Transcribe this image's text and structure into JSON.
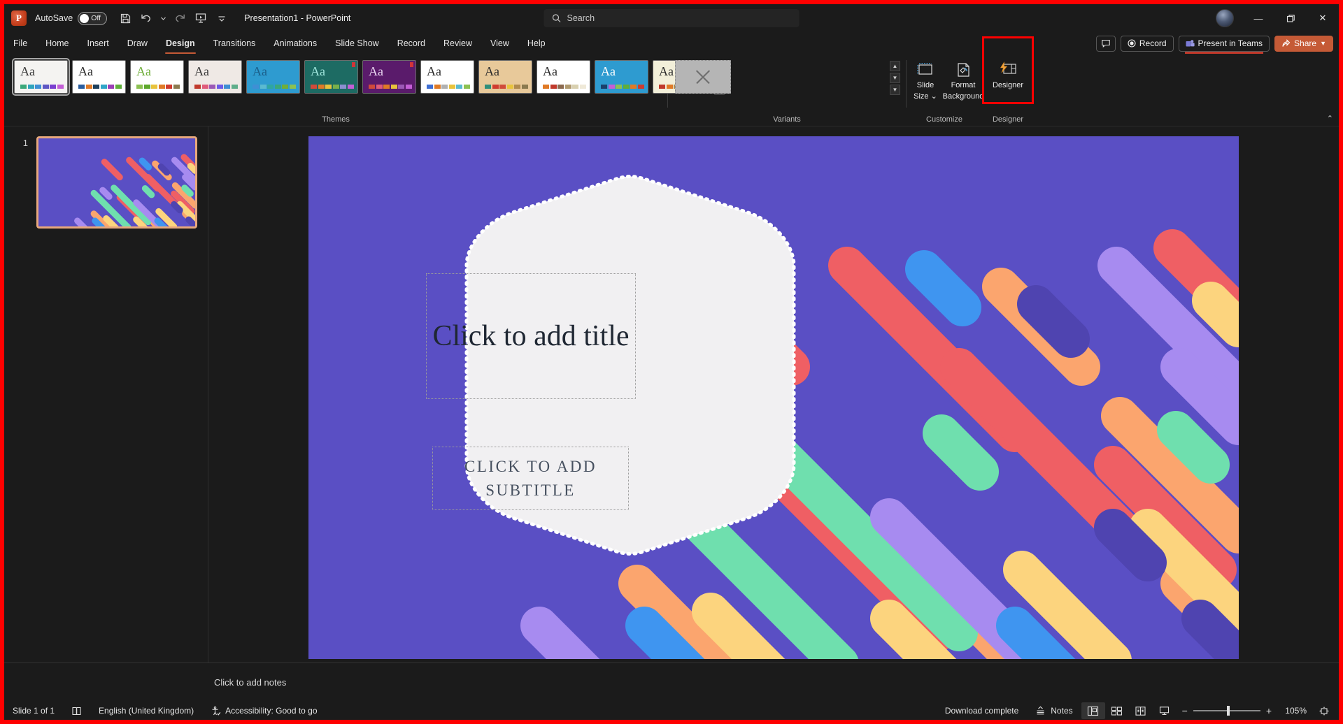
{
  "titlebar": {
    "app_logo": "powerpoint-logo",
    "autosave_label": "AutoSave",
    "autosave_state": "Off",
    "quick_access": [
      {
        "name": "save-icon",
        "tooltip": "Save"
      },
      {
        "name": "undo-icon",
        "tooltip": "Undo"
      },
      {
        "name": "undo-dropdown-icon",
        "tooltip": "Undo options"
      },
      {
        "name": "redo-icon",
        "tooltip": "Redo"
      },
      {
        "name": "start-from-beginning-icon",
        "tooltip": "Start From Beginning"
      },
      {
        "name": "customize-quick-access-toolbar-icon",
        "tooltip": "Customize Quick Access Toolbar"
      }
    ],
    "document_title": "Presentation1  -  PowerPoint",
    "window_controls": {
      "minimize": "—",
      "restore": "❐",
      "close": "✕"
    }
  },
  "search": {
    "placeholder": "Search"
  },
  "tabs": [
    {
      "label": "File",
      "active": false
    },
    {
      "label": "Home",
      "active": false
    },
    {
      "label": "Insert",
      "active": false
    },
    {
      "label": "Draw",
      "active": false
    },
    {
      "label": "Design",
      "active": true
    },
    {
      "label": "Transitions",
      "active": false
    },
    {
      "label": "Animations",
      "active": false
    },
    {
      "label": "Slide Show",
      "active": false
    },
    {
      "label": "Record",
      "active": false
    },
    {
      "label": "Review",
      "active": false
    },
    {
      "label": "View",
      "active": false
    },
    {
      "label": "Help",
      "active": false
    }
  ],
  "tabstrip_right": {
    "comments_icon": "comment-icon",
    "record_label": "Record",
    "present_in_teams_label": "Present in Teams",
    "share_label": "Share"
  },
  "ribbon": {
    "groups": [
      {
        "name": "Themes",
        "label": "Themes"
      },
      {
        "name": "Variants",
        "label": "Variants"
      },
      {
        "name": "Customize",
        "label": "Customize"
      },
      {
        "name": "Designer",
        "label": "Designer"
      }
    ],
    "themes": [
      {
        "id": "office-theme",
        "aa": "Aa",
        "selected": true,
        "bg": "#f4f3f1",
        "aa_color": "#3a3a3a",
        "swatches": [
          "#3aa87a",
          "#2fa4bd",
          "#3f8fd4",
          "#5e57c4",
          "#7a3fd0",
          "#c45fd6"
        ],
        "marked": false
      },
      {
        "id": "theme-2",
        "aa": "Aa",
        "selected": false,
        "bg": "#ffffff",
        "aa_color": "#2b2b2b",
        "swatches": [
          "#2a5d9e",
          "#e07a26",
          "#1d3f5c",
          "#2fa6c8",
          "#9b3fb5",
          "#5fae3a"
        ],
        "marked": false
      },
      {
        "id": "theme-facet",
        "aa": "Aa",
        "selected": false,
        "bg": "#ffffff",
        "aa_color": "#6fae3a",
        "swatches": [
          "#8cc152",
          "#5ea82c",
          "#e8c33c",
          "#e07a26",
          "#cf3b2f",
          "#8b7a4f"
        ],
        "marked": false
      },
      {
        "id": "theme-wisp",
        "aa": "Aa",
        "selected": false,
        "bg": "#efe9e5",
        "aa_color": "#3a3a3a",
        "swatches": [
          "#c0392b",
          "#e05b7a",
          "#9b59b6",
          "#6c5ce7",
          "#3f8fd4",
          "#5fae8a"
        ],
        "marked": false
      },
      {
        "id": "theme-badge",
        "aa": "Aa",
        "selected": false,
        "bg": "#2e9bd0",
        "aa_color": "#1b5f8a",
        "swatches": [
          "#3f8fd4",
          "#5bbad0",
          "#2fa6a0",
          "#3aa87a",
          "#6fae3a",
          "#8cc152"
        ],
        "marked": false
      },
      {
        "id": "theme-ion-teal",
        "aa": "Aa",
        "selected": false,
        "bg": "#1d6b63",
        "aa_color": "#9fe5dc",
        "swatches": [
          "#d04a3a",
          "#e07a26",
          "#e8c33c",
          "#7ab04a",
          "#8b8fd0",
          "#c45fd6"
        ],
        "marked": true
      },
      {
        "id": "theme-ion-purple",
        "aa": "Aa",
        "selected": false,
        "bg": "#5a1b6b",
        "aa_color": "#e8d4f0",
        "swatches": [
          "#d04a3a",
          "#e05b7a",
          "#e07a26",
          "#e8c33c",
          "#9b59b6",
          "#c45fd6"
        ],
        "marked": true
      },
      {
        "id": "theme-retrospect",
        "aa": "Aa",
        "selected": false,
        "bg": "#ffffff",
        "aa_color": "#2b2b2b",
        "swatches": [
          "#3f6fd4",
          "#e07a26",
          "#b0b0b0",
          "#e8c33c",
          "#5bbad0",
          "#8cc152"
        ],
        "marked": false
      },
      {
        "id": "theme-savon",
        "aa": "Aa",
        "selected": false,
        "bg": "#e8c99a",
        "aa_color": "#2b2b2b",
        "swatches": [
          "#2f8f7a",
          "#cf3b2f",
          "#d04a3a",
          "#e8c33c",
          "#b08a4f",
          "#8b7a4f"
        ],
        "marked": false
      },
      {
        "id": "theme-frame",
        "aa": "Aa",
        "selected": false,
        "bg": "#ffffff",
        "aa_color": "#2b2b2b",
        "swatches": [
          "#e07a26",
          "#c0392b",
          "#8b6a4f",
          "#b09a6f",
          "#d8d0b0",
          "#efe9d8"
        ],
        "marked": false
      },
      {
        "id": "theme-celestial",
        "aa": "Aa",
        "selected": false,
        "bg": "#2e9bd0",
        "aa_color": "#ffffff",
        "swatches": [
          "#1b3f6b",
          "#c45fd6",
          "#8cc152",
          "#5fae3a",
          "#e07a26",
          "#cf3b2f"
        ],
        "marked": false
      },
      {
        "id": "theme-vapor",
        "aa": "Aa",
        "selected": false,
        "bg": "#f2efd9",
        "aa_color": "#2b2b2b",
        "swatches": [
          "#c0392b",
          "#e07a26",
          "#b08a4f",
          "#7aae5a",
          "#8cc152",
          "#5fbda8"
        ],
        "marked": false
      }
    ],
    "gallery_buttons": [
      {
        "name": "themes-scroll-up",
        "glyph": "▲"
      },
      {
        "name": "themes-scroll-down",
        "glyph": "▼"
      },
      {
        "name": "themes-more",
        "glyph": "▼"
      }
    ],
    "variants_buttons": [
      {
        "name": "variants-scroll-up",
        "glyph": "▲"
      },
      {
        "name": "variants-scroll-down",
        "glyph": "▼"
      },
      {
        "name": "variants-more",
        "glyph": "▼"
      }
    ],
    "customize": [
      {
        "name": "slide-size-button",
        "line1": "Slide",
        "line2": "Size ⌄",
        "icon": "slide-size-icon"
      },
      {
        "name": "format-background-button",
        "line1": "Format",
        "line2": "Background",
        "icon": "format-background-icon"
      }
    ],
    "designer": {
      "label": "Designer",
      "icon": "designer-icon",
      "highlighted": true,
      "highlight_color": "#ff0000"
    },
    "collapse_ribbon_glyph": "⌃"
  },
  "slides_pane": {
    "slides": [
      {
        "number": "1",
        "selected": true
      }
    ]
  },
  "slide": {
    "background_color": "#5a4fc4",
    "title_placeholder": "Click to add title",
    "subtitle_placeholder": "CLICK TO ADD SUBTITLE",
    "card_color": "#f1f0f2",
    "palette": {
      "purple_bg": "#5a4fc4",
      "dark_purple": "#4f44b0",
      "red": "#ef5f64",
      "orange": "#fba56e",
      "yellow": "#fcd47e",
      "green": "#6fdfae",
      "lilac": "#a78bf0",
      "blue": "#3f95f0"
    }
  },
  "notes": {
    "placeholder": "Click to add notes"
  },
  "statusbar": {
    "slide_count": "Slide 1 of 1",
    "accessibility_icon": "accessibility-icon",
    "language": "English (United Kingdom)",
    "accessibility": "Accessibility: Good to go",
    "download_status": "Download complete",
    "notes_label": "Notes",
    "views": [
      {
        "name": "normal-view-button",
        "active": true
      },
      {
        "name": "slide-sorter-view-button",
        "active": false
      },
      {
        "name": "reading-view-button",
        "active": false
      },
      {
        "name": "slide-show-button",
        "active": false
      }
    ],
    "zoom_out": "−",
    "zoom_in": "+",
    "zoom_level": "105%",
    "fit_slide_icon": "fit-to-window-icon"
  }
}
